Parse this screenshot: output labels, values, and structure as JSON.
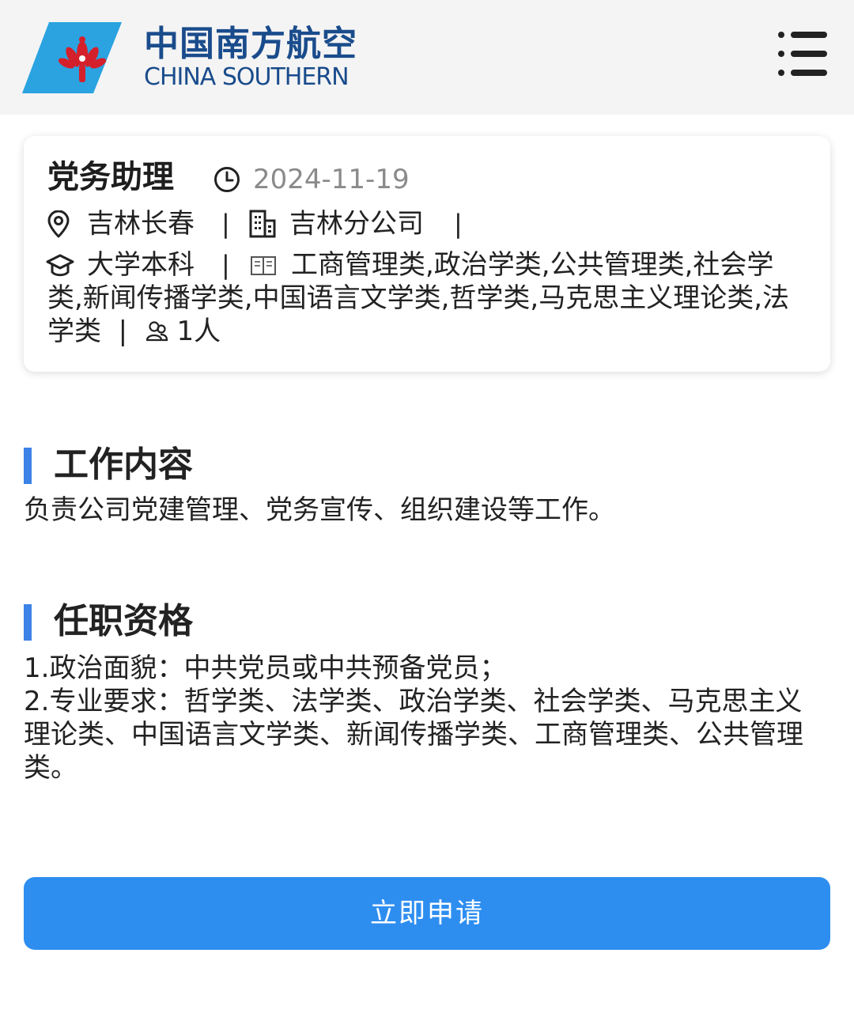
{
  "header": {
    "brand_cn": "中国南方航空",
    "brand_en": "CHINA SOUTHERN",
    "logo_icon": "kapok-flower-icon",
    "menu_icon": "menu-list-icon",
    "brand_color": "#1a4c8c",
    "logo_blue": "#2aa3e0",
    "logo_red": "#d4202b"
  },
  "job": {
    "title": "党务助理",
    "date": "2024-11-19",
    "location": "吉林长春",
    "company": "吉林分公司",
    "education": "大学本科",
    "majors": "工商管理类,政治学类,公共管理类,社会学类,新闻传播学类,中国语言文学类,哲学类,马克思主义理论类,法学类",
    "headcount": "1人",
    "separator": "|"
  },
  "sections": {
    "duties": {
      "title": "工作内容",
      "body": "负责公司党建管理、党务宣传、组织建设等工作。"
    },
    "requirements": {
      "title": "任职资格",
      "line1": "1.政治面貌：中共党员或中共预备党员；",
      "line2": "2.专业要求：哲学类、法学类、政治学类、社会学类、马克思主义理论类、中国语言文学类、新闻传播学类、工商管理类、公共管理类。"
    }
  },
  "actions": {
    "apply_label": "立即申请",
    "apply_color": "#2e8ef0"
  },
  "accent_color": "#3d82e6"
}
